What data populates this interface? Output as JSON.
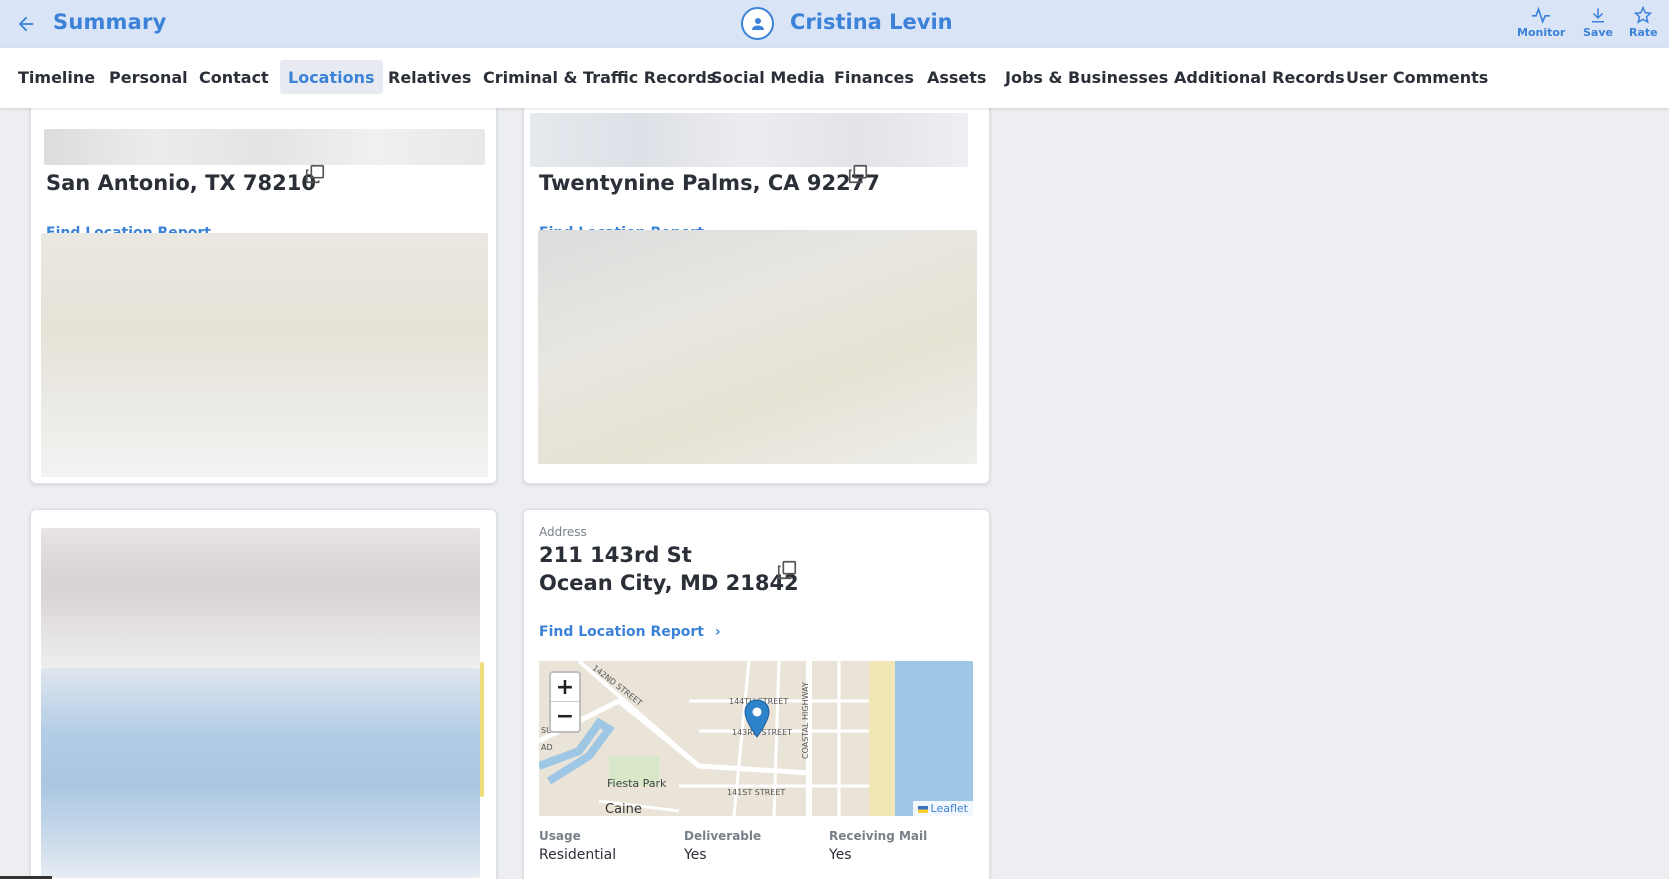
{
  "header": {
    "title": "Summary",
    "person_name": "Cristina Levin",
    "actions": {
      "monitor": "Monitor",
      "save": "Save",
      "rate": "Rate"
    }
  },
  "tabs": [
    {
      "label": "Timeline"
    },
    {
      "label": "Personal"
    },
    {
      "label": "Contact"
    },
    {
      "label": "Locations",
      "active": true
    },
    {
      "label": "Relatives"
    },
    {
      "label": "Criminal & Traffic Records"
    },
    {
      "label": "Social Media"
    },
    {
      "label": "Finances"
    },
    {
      "label": "Assets"
    },
    {
      "label": "Jobs & Businesses"
    },
    {
      "label": "Additional Records"
    },
    {
      "label": "User Comments"
    }
  ],
  "locations": [
    {
      "line2": "San Antonio, TX 78210",
      "find_label": "Find Location Report"
    },
    {
      "line2": "Twentynine Palms, CA 92277",
      "find_label": "Find Location Report"
    },
    {
      "address_label": "Address",
      "line1": "211 143rd St",
      "line2": "Ocean City, MD 21842",
      "find_label": "Find Location Report",
      "map": {
        "streets": [
          "142ND STREET",
          "144TH STREET",
          "143RD STREET",
          "141ST STREET",
          "COASTAL HIGHWAY",
          "SURF",
          "AD"
        ],
        "places": [
          "Fiesta Park",
          "Caine"
        ],
        "zoom_in": "+",
        "zoom_out": "−",
        "attribution": "Leaflet"
      },
      "details": [
        {
          "label": "Usage",
          "value": "Residential"
        },
        {
          "label": "Deliverable",
          "value": "Yes"
        },
        {
          "label": "Receiving Mail",
          "value": "Yes"
        }
      ]
    }
  ],
  "colors": {
    "accent": "#3b82d8",
    "header_bg": "#d9e5f7",
    "page_bg": "#eceef2"
  }
}
